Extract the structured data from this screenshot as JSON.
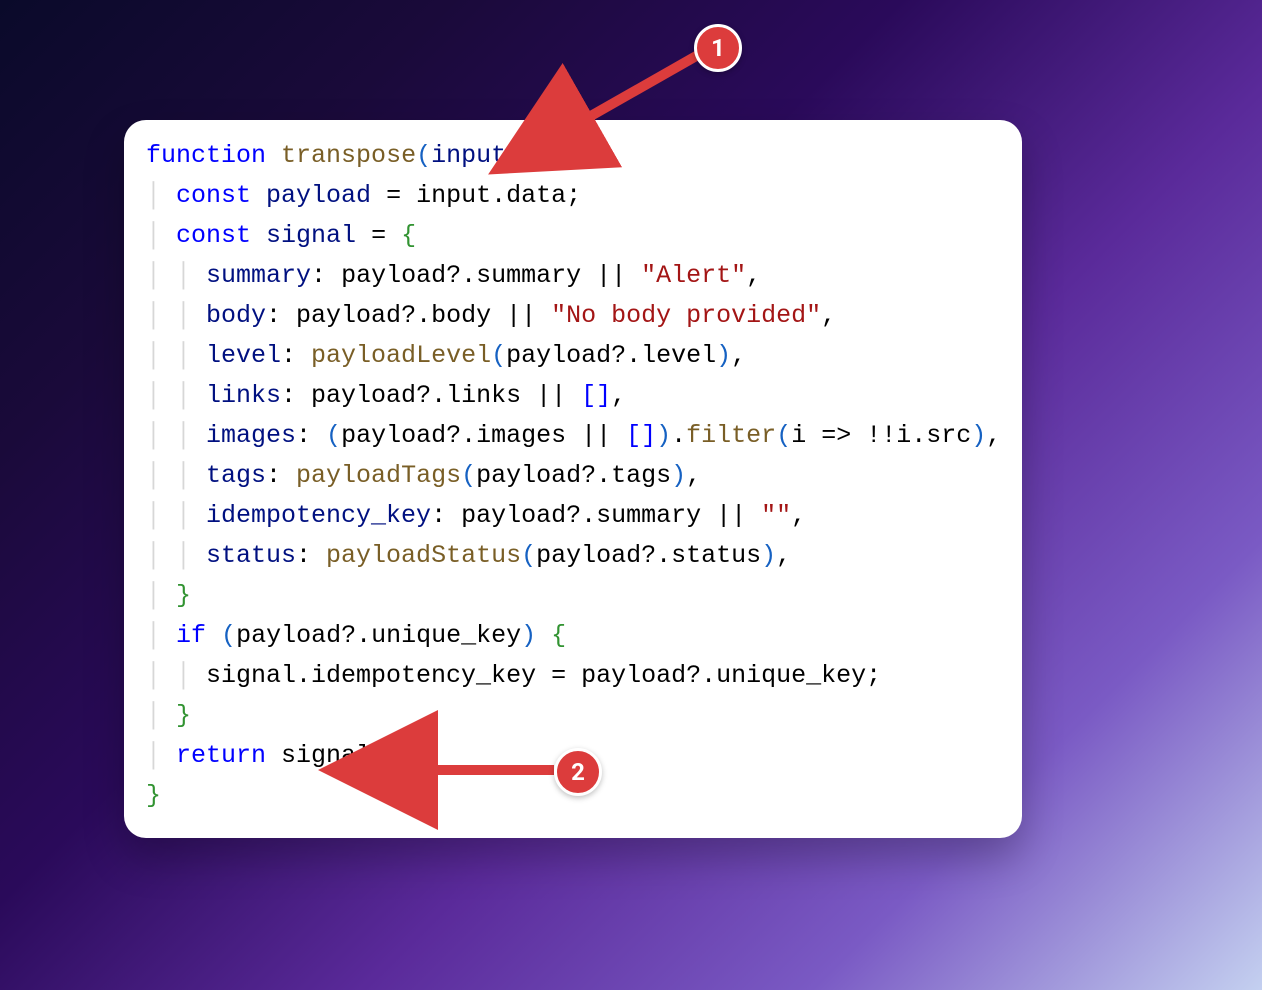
{
  "annotations": {
    "badge1": "1",
    "badge2": "2"
  },
  "code": {
    "line1": {
      "kw_function": "function",
      "fn_name": "transpose",
      "lparen": "(",
      "param": "input",
      "rparen": ")",
      "space": " ",
      "lbrace": "{"
    },
    "line2": {
      "indent": "│ ",
      "kw_const": "const",
      "sp1": " ",
      "name": "payload",
      "sp2": " ",
      "eq": "=",
      "sp3": " ",
      "expr": "input.data;"
    },
    "line3": {
      "indent": "│ ",
      "kw_const": "const",
      "sp1": " ",
      "name": "signal",
      "sp2": " ",
      "eq": "=",
      "sp3": " ",
      "lbrace": "{"
    },
    "line4": {
      "indent": "│ │ ",
      "prop": "summary",
      "colon": ": ",
      "expr": "payload?.summary || ",
      "str": "\"Alert\"",
      "comma": ","
    },
    "line5": {
      "indent": "│ │ ",
      "prop": "body",
      "colon": ": ",
      "expr": "payload?.body || ",
      "str": "\"No body provided\"",
      "comma": ","
    },
    "line6": {
      "indent": "│ │ ",
      "prop": "level",
      "colon": ": ",
      "fn": "payloadLevel",
      "lparen": "(",
      "arg": "payload?.level",
      "rparen": ")",
      "comma": ","
    },
    "line7": {
      "indent": "│ │ ",
      "prop": "links",
      "colon": ": ",
      "expr": "payload?.links || ",
      "lb": "[",
      "rb": "]",
      "comma": ","
    },
    "line8": {
      "indent": "│ │ ",
      "prop": "images",
      "colon": ": ",
      "lparen1": "(",
      "expr1": "payload?.images || ",
      "lb": "[",
      "rb": "]",
      "rparen1": ")",
      "dot": ".",
      "fn": "filter",
      "lparen2": "(",
      "arrow": "i => !!i.src",
      "rparen2": ")",
      "comma": ","
    },
    "line9": {
      "indent": "│ │ ",
      "prop": "tags",
      "colon": ": ",
      "fn": "payloadTags",
      "lparen": "(",
      "arg": "payload?.tags",
      "rparen": ")",
      "comma": ","
    },
    "line10": {
      "indent": "│ │ ",
      "prop": "idempotency_key",
      "colon": ": ",
      "expr": "payload?.summary || ",
      "str": "\"\"",
      "comma": ","
    },
    "line11": {
      "indent": "│ │ ",
      "prop": "status",
      "colon": ": ",
      "fn": "payloadStatus",
      "lparen": "(",
      "arg": "payload?.status",
      "rparen": ")",
      "comma": ","
    },
    "line12": {
      "indent": "│ ",
      "rbrace": "}"
    },
    "line13": {
      "indent": "│ ",
      "kw_if": "if",
      "sp": " ",
      "lparen": "(",
      "cond": "payload?.unique_key",
      "rparen": ")",
      "sp2": " ",
      "lbrace": "{"
    },
    "line14": {
      "indent": "│ │ ",
      "expr": "signal.idempotency_key = payload?.unique_key;"
    },
    "line15": {
      "indent": "│ ",
      "rbrace": "}"
    },
    "line16": {
      "indent": "│ ",
      "kw_return": "return",
      "sp": " ",
      "expr": "signal;"
    },
    "line17": {
      "rbrace": "}"
    }
  }
}
